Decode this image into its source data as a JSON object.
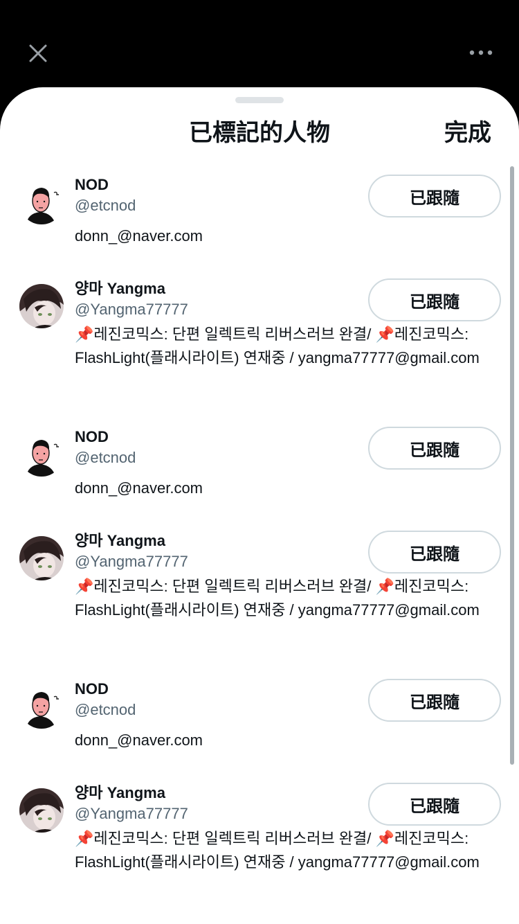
{
  "sheet": {
    "title": "已標記的人物",
    "done_label": "完成"
  },
  "top_bar": {
    "close_icon": "close-icon",
    "more_icon": "more-horizontal-icon"
  },
  "colors": {
    "text_primary": "#0f1419",
    "text_secondary": "#536471",
    "button_border": "#cfd9de"
  },
  "users": [
    {
      "name": "NOD",
      "handle": "@etcnod",
      "bio": "donn_@naver.com",
      "follow_label": "已跟隨",
      "avatar": "nod-avatar"
    },
    {
      "name": "양마 Yangma",
      "handle": "@Yangma77777",
      "bio": "📌레진코믹스: 단편 일렉트릭 리버스러브 완결/ 📌레진코믹스: FlashLight(플래시라이트) 연재중 / yangma77777@gmail.com",
      "follow_label": "已跟隨",
      "avatar": "yangma-avatar"
    },
    {
      "name": "NOD",
      "handle": "@etcnod",
      "bio": "donn_@naver.com",
      "follow_label": "已跟隨",
      "avatar": "nod-avatar"
    },
    {
      "name": "양마 Yangma",
      "handle": "@Yangma77777",
      "bio": "📌레진코믹스: 단편 일렉트릭 리버스러브 완결/ 📌레진코믹스: FlashLight(플래시라이트) 연재중 / yangma77777@gmail.com",
      "follow_label": "已跟隨",
      "avatar": "yangma-avatar"
    },
    {
      "name": "NOD",
      "handle": "@etcnod",
      "bio": "donn_@naver.com",
      "follow_label": "已跟隨",
      "avatar": "nod-avatar"
    },
    {
      "name": "양마 Yangma",
      "handle": "@Yangma77777",
      "bio": "📌레진코믹스: 단편 일렉트릭 리버스러브 완결/ 📌레진코믹스: FlashLight(플래시라이트) 연재중 / yangma77777@gmail.com",
      "follow_label": "已跟隨",
      "avatar": "yangma-avatar"
    }
  ]
}
